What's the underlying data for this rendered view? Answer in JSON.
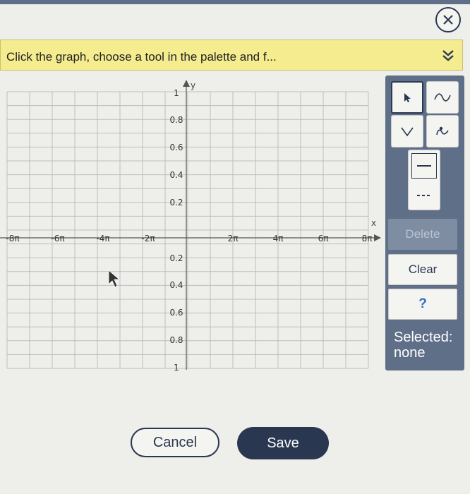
{
  "dialog": {
    "hint": "Click the graph, choose a tool in the palette and f...",
    "close_icon": "close-circle-icon",
    "collapse_icon": "double-chevron-down-icon"
  },
  "graph": {
    "x_axis_label": "x",
    "y_axis_label": "y",
    "x_ticks": [
      "-8π",
      "-6π",
      "-4π",
      "-2π",
      "2π",
      "4π",
      "6π",
      "8π"
    ],
    "y_ticks_pos": [
      "1",
      "0.8",
      "0.6",
      "0.4",
      "0.2"
    ],
    "y_ticks_neg": [
      "0.2",
      "0.4",
      "0.6",
      "0.8",
      "1"
    ],
    "x_range_pi": [
      -8,
      8
    ],
    "y_range": [
      -1,
      1
    ],
    "grid": true
  },
  "palette": {
    "tools": [
      {
        "name": "pointer-tool",
        "icon": "arrow-pointer-icon",
        "selected": true
      },
      {
        "name": "sine-tool",
        "icon": "sine-wave-icon",
        "selected": false
      },
      {
        "name": "absolute-value-tool",
        "icon": "v-shape-icon",
        "selected": false
      },
      {
        "name": "cosine-tool",
        "icon": "cosine-wave-icon",
        "selected": false
      },
      {
        "name": "solid-line-tool",
        "icon": "solid-line-icon",
        "selected": false
      },
      {
        "name": "dashed-line-tool",
        "icon": "dashed-line-icon",
        "selected": false
      }
    ],
    "delete_label": "Delete",
    "clear_label": "Clear",
    "help_label": "?",
    "selected_label": "Selected:",
    "selected_value": "none"
  },
  "footer": {
    "cancel_label": "Cancel",
    "save_label": "Save"
  },
  "colors": {
    "palette_bg": "#5f6f88",
    "hint_bg": "#f4ec8f",
    "save_bg": "#2a3750"
  }
}
